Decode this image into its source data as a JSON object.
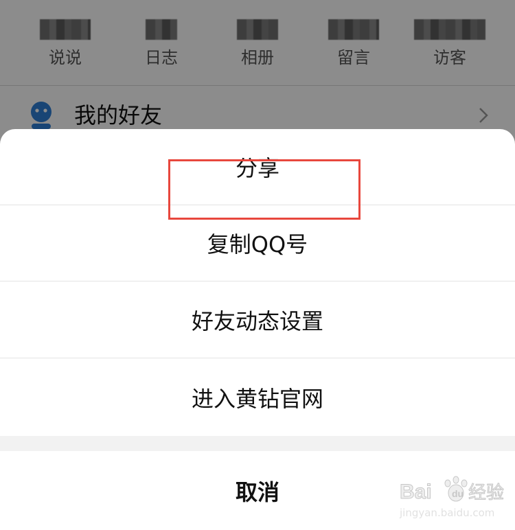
{
  "stats": [
    {
      "label": "说说"
    },
    {
      "label": "日志"
    },
    {
      "label": "相册"
    },
    {
      "label": "留言"
    },
    {
      "label": "访客"
    }
  ],
  "friends_row": {
    "label": "我的好友",
    "icon": "friends-icon"
  },
  "action_sheet": {
    "items": [
      {
        "label": "分享"
      },
      {
        "label": "复制QQ号"
      },
      {
        "label": "好友动态设置"
      },
      {
        "label": "进入黄钻官网"
      }
    ],
    "cancel_label": "取消"
  },
  "highlight": {
    "target": "好友动态设置",
    "color": "#e8473d"
  },
  "watermark": {
    "brand": "Baidu经验",
    "url": "jingyan.baidu.com"
  },
  "colors": {
    "overlay": "rgba(0,0,0,0.45)",
    "friends_icon": "#2f7fd6"
  }
}
